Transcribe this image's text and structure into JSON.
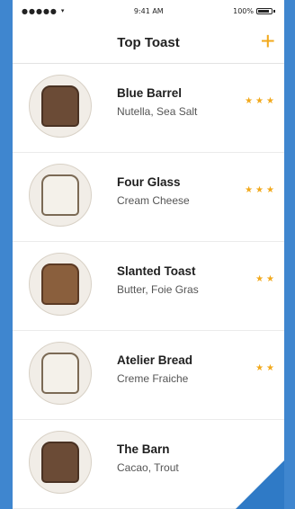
{
  "status": {
    "time": "9:41 AM",
    "battery": "100%"
  },
  "nav": {
    "title": "Top Toast",
    "add_label": "+"
  },
  "items": [
    {
      "name": "Blue Barrel",
      "toppings": "Nutella, Sea Salt",
      "stars": "★★★"
    },
    {
      "name": "Four Glass",
      "toppings": "Cream Cheese",
      "stars": "★★★"
    },
    {
      "name": "Slanted Toast",
      "toppings": "Butter, Foie Gras",
      "stars": "★★"
    },
    {
      "name": "Atelier Bread",
      "toppings": "Creme Fraiche",
      "stars": "★★"
    },
    {
      "name": "The Barn",
      "toppings": "Cacao, Trout",
      "stars": ""
    }
  ]
}
